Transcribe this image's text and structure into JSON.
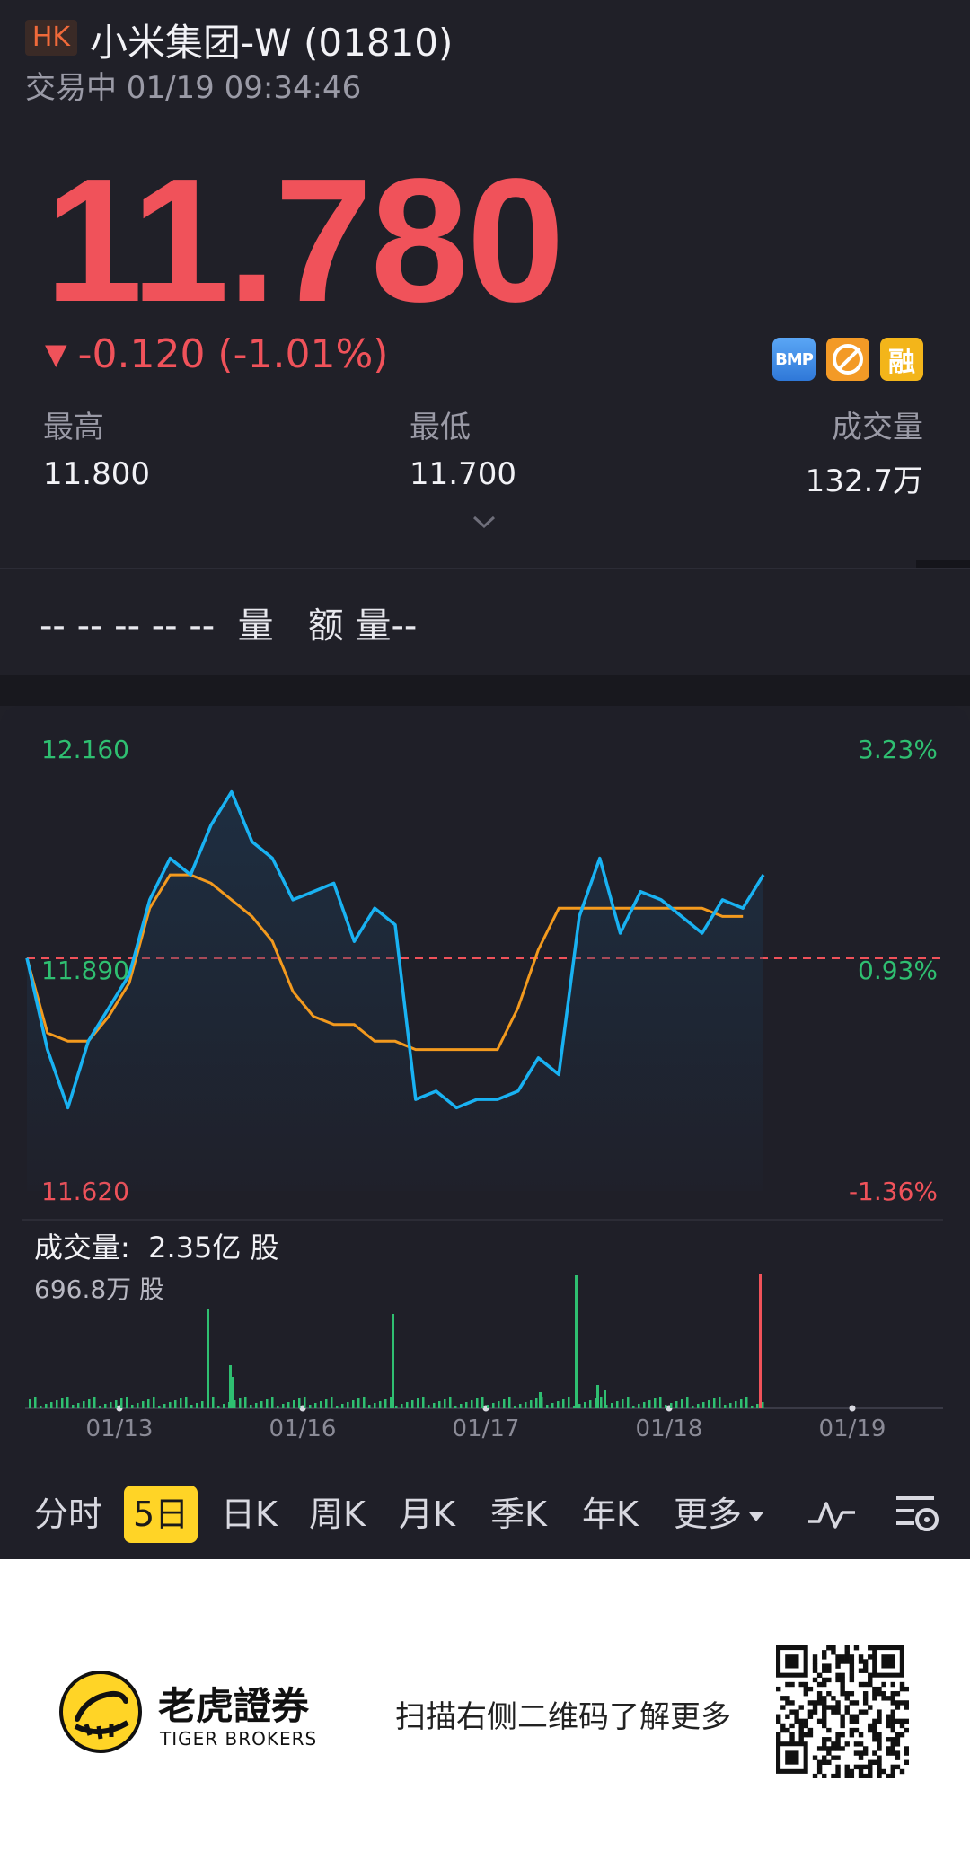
{
  "header": {
    "market": "HK",
    "name": "小米集团-W (01810)",
    "status": "交易中 01/19 09:34:46"
  },
  "quote": {
    "price": "11.780",
    "change_arrow": "▼",
    "change": "-0.120 (-1.01%)",
    "badges": [
      "BMP",
      "no-short-icon",
      "融"
    ]
  },
  "stats": [
    {
      "label": "最高",
      "value": "11.800"
    },
    {
      "label": "最低",
      "value": "11.700"
    },
    {
      "label": "成交量",
      "value": "132.7万"
    }
  ],
  "strip": {
    "text": "-- -- -- -- --  量   额 量--"
  },
  "chart": {
    "y_left": [
      "12.160",
      "11.890",
      "11.620"
    ],
    "y_right": [
      "3.23%",
      "0.93%",
      "-1.36%"
    ],
    "volume_title": "成交量:  2.35亿 股",
    "volume_sub": "696.8万 股",
    "dates": [
      "01/13",
      "01/16",
      "01/17",
      "01/18",
      "01/19"
    ]
  },
  "chart_data": {
    "type": "line",
    "ylim": [
      11.62,
      12.16
    ],
    "y_right_range": [
      "-1.36%",
      "3.23%"
    ],
    "reference_price": 11.9,
    "categories": [
      "01/13",
      "01/16",
      "01/17",
      "01/18",
      "01/19"
    ],
    "series": [
      {
        "values": [
          11.9,
          11.79,
          11.72,
          11.8,
          11.84,
          11.88,
          11.97,
          12.02,
          12.0,
          12.06,
          12.1,
          12.04,
          12.02,
          11.97,
          11.98,
          11.99,
          11.92,
          11.96,
          11.94,
          11.73,
          11.74,
          11.72,
          11.73,
          11.73,
          11.74,
          11.78,
          11.76,
          11.95,
          12.02,
          11.93,
          11.98,
          11.97,
          11.95,
          11.93,
          11.97,
          11.96,
          12.0
        ]
      },
      {
        "values": [
          11.9,
          11.81,
          11.8,
          11.8,
          11.83,
          11.87,
          11.96,
          12.0,
          12.0,
          11.99,
          11.97,
          11.95,
          11.92,
          11.86,
          11.83,
          11.82,
          11.82,
          11.8,
          11.8,
          11.79,
          11.79,
          11.79,
          11.79,
          11.79,
          11.84,
          11.91,
          11.96,
          11.96,
          11.96,
          11.96,
          11.96,
          11.96,
          11.96,
          11.96,
          11.95,
          11.95
        ]
      }
    ],
    "volume_color_up": "#2fbf71",
    "volume_color_down": "#f0525a"
  },
  "tabs": [
    "分时",
    "5日",
    "日K",
    "周K",
    "月K",
    "季K",
    "年K",
    "更多"
  ],
  "tools": [
    "indicator-icon",
    "settings-icon"
  ],
  "footer": {
    "brand_cn": "老虎證券",
    "brand_en": "TIGER BROKERS",
    "scan": "扫描右侧二维码了解更多"
  },
  "colors": {
    "up_red": "#f0525a",
    "down_green": "#2fbf71",
    "line_blue": "#19b2f2",
    "avg_orange": "#f39a1e",
    "active_tab": "#ffd426"
  }
}
